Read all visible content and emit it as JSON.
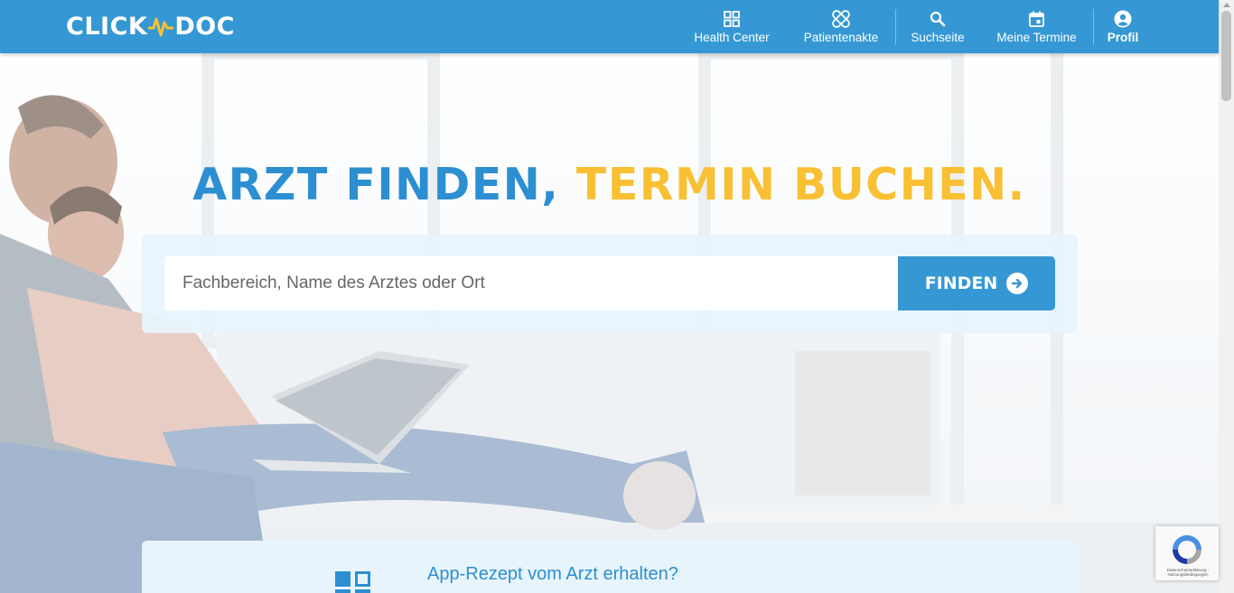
{
  "header": {
    "logo": {
      "left": "CLICK",
      "right": "DOC"
    },
    "nav": [
      {
        "label": "Health Center",
        "icon": "grid-icon"
      },
      {
        "label": "Patientenakte",
        "icon": "bandage-icon"
      },
      {
        "label": "Suchseite",
        "icon": "search-icon"
      },
      {
        "label": "Meine Termine",
        "icon": "calendar-icon"
      },
      {
        "label": "Profil",
        "icon": "user-circle-icon"
      }
    ]
  },
  "hero": {
    "headline_blue": "ARZT FINDEN,",
    "headline_yellow": "TERMIN BUCHEN.",
    "search": {
      "placeholder": "Fachbereich, Name des Arztes oder Ort",
      "value": ""
    },
    "find_button": "FINDEN"
  },
  "info": {
    "text": "App-Rezept vom Arzt erhalten?"
  },
  "recaptcha": {
    "text": "Datenschutzerklärung - Nutzungsbedingungen"
  },
  "colors": {
    "header": "#3598d4",
    "brand_blue": "#2c8fd1",
    "brand_yellow": "#f8c032",
    "card_bg": "#e8f4fc"
  }
}
